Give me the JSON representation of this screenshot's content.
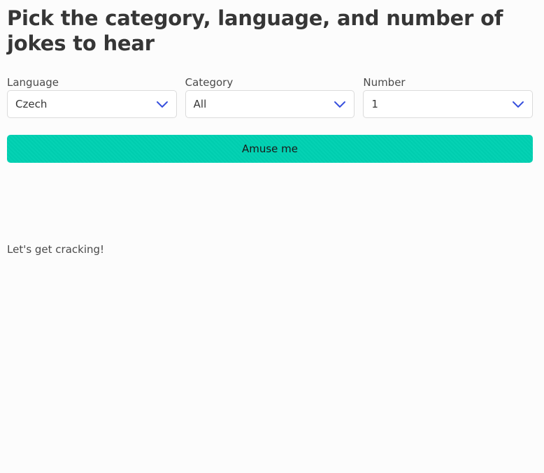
{
  "heading": "Pick the category, language, and number of jokes to hear",
  "form": {
    "language": {
      "label": "Language",
      "value": "Czech"
    },
    "category": {
      "label": "Category",
      "value": "All"
    },
    "number": {
      "label": "Number",
      "value": "1"
    }
  },
  "action": {
    "label": "Amuse me"
  },
  "status_text": "Let's get cracking!",
  "icons": {
    "select_arrow": "chevron-down-icon"
  },
  "colors": {
    "accent": "#00d1b2",
    "chevron": "#3850dd",
    "text": "#363636",
    "background": "#fcfcfc"
  }
}
